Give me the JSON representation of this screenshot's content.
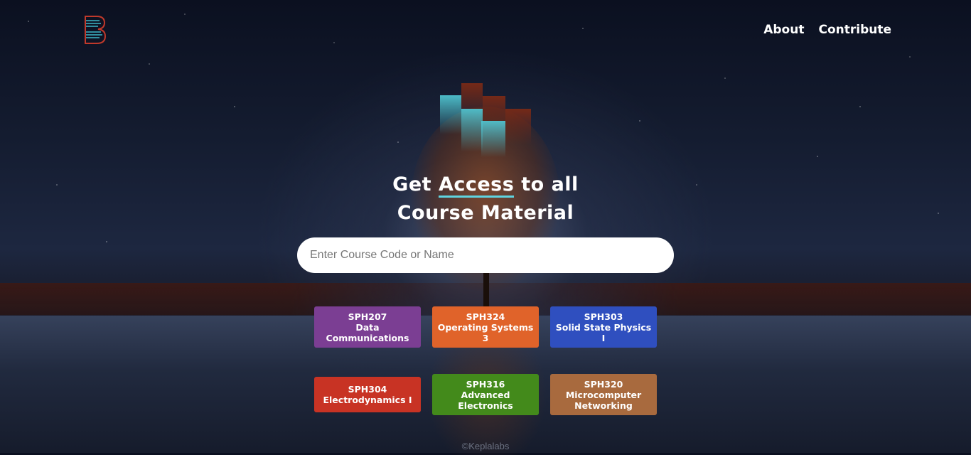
{
  "nav": {
    "about": "About",
    "contribute": "Contribute"
  },
  "headline": {
    "line1_before": "Get ",
    "line1_accent": "Access",
    "line1_after": " to all",
    "line2": "Course Material"
  },
  "search": {
    "placeholder": "Enter Course Code or Name",
    "value": ""
  },
  "courses": [
    {
      "code": "SPH207",
      "name": "Data Communications",
      "color": "#7b3e93"
    },
    {
      "code": "SPH324",
      "name": "Operating Systems 3",
      "color": "#e0632a"
    },
    {
      "code": "SPH303",
      "name": "Solid State Physics I",
      "color": "#2f4fbf"
    },
    {
      "code": "SPH304",
      "name": "Electrodynamics I",
      "color": "#c83324"
    },
    {
      "code": "SPH316",
      "name": "Advanced Electronics",
      "color": "#438a1b"
    },
    {
      "code": "SPH320",
      "name": "Microcomputer Networking",
      "color": "#a86a3e"
    }
  ],
  "footer": "©Keplalabs",
  "colors": {
    "accent_underline": "#5fd4e0",
    "logo_outline": "#c0392b",
    "logo_lines": "#3fb8c8"
  }
}
